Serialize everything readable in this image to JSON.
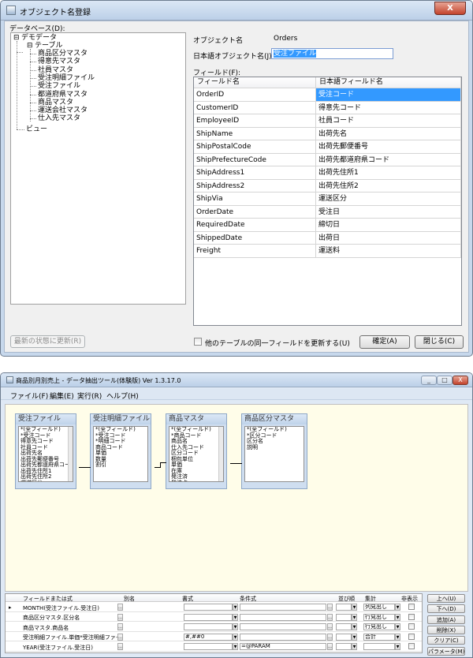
{
  "dialog": {
    "title": "オブジェクト名登録",
    "close_glyph": "X",
    "database_label": "データベース(D):",
    "tree": {
      "root": "デモデータ",
      "tables_node": "テーブル",
      "tables": [
        "商品区分マスタ",
        "得意先マスタ",
        "社員マスタ",
        "受注明細ファイル",
        "受注ファイル",
        "都道府県マスタ",
        "商品マスタ",
        "運送会社マスタ",
        "仕入先マスタ"
      ],
      "views_node": "ビュー"
    },
    "object_name_label": "オブジェクト名",
    "object_name_value": "Orders",
    "jp_object_name_label": "日本語オブジェクト名(J):",
    "jp_object_name_value": "受注ファイル",
    "fields_label": "フィールド(F):",
    "grid_headers": [
      "フィールド名",
      "日本語フィールド名"
    ],
    "grid_rows": [
      [
        "OrderID",
        "受注コード"
      ],
      [
        "CustomerID",
        "得意先コード"
      ],
      [
        "EmployeeID",
        "社員コード"
      ],
      [
        "ShipName",
        "出荷先名"
      ],
      [
        "ShipPostalCode",
        "出荷先郵便番号"
      ],
      [
        "ShipPrefectureCode",
        "出荷先都道府県コード"
      ],
      [
        "ShipAddress1",
        "出荷先住所1"
      ],
      [
        "ShipAddress2",
        "出荷先住所2"
      ],
      [
        "ShipVia",
        "運送区分"
      ],
      [
        "OrderDate",
        "受注日"
      ],
      [
        "RequiredDate",
        "締切日"
      ],
      [
        "ShippedDate",
        "出荷日"
      ],
      [
        "Freight",
        "運送料"
      ]
    ],
    "refresh_button": "最新の状態に更新(R)",
    "update_checkbox_label": "他のテーブルの同一フィールドを更新する(U)",
    "ok_button": "確定(A)",
    "close_button": "閉じる(C)"
  },
  "app": {
    "title": "商品別月別売上 - データ抽出ツール(体験版) Ver 1.3.17.0",
    "caption_min": "_",
    "caption_max": "□",
    "caption_close": "X",
    "menu": [
      "ファイル(F)",
      "編集(E)",
      "実行(R)",
      "ヘルプ(H)"
    ],
    "tables": [
      {
        "title": "受注ファイル",
        "fields": [
          "*(全フィールド)",
          "*受注コード",
          "得意先コード",
          "社員コード",
          "出荷先名",
          "出荷先郵便番号",
          "出荷先都道府県コード",
          "出荷先住所1",
          "出荷先住所2",
          "運送区分",
          "受注日",
          "締切日"
        ]
      },
      {
        "title": "受注明細ファイル",
        "fields": [
          "*(全フィールド)",
          "*受注コード",
          "*明細コード",
          "商品コード",
          "単価",
          "数量",
          "割引"
        ]
      },
      {
        "title": "商品マスタ",
        "fields": [
          "*(全フィールド)",
          "*商品コード",
          "商品名",
          "仕入先コード",
          "区分コード",
          "梱包単位",
          "単価",
          "在庫",
          "発注済",
          "発注点",
          "生産中止"
        ]
      },
      {
        "title": "商品区分マスタ",
        "fields": [
          "*(全フィールド)",
          "*区分コード",
          "区分名",
          "説明"
        ]
      }
    ],
    "grid_headers": [
      "フィールドまたは式",
      "別名",
      "書式",
      "条件式",
      "並び順",
      "集計",
      "非表示"
    ],
    "grid_rows": [
      {
        "marker": "▸",
        "field": "MONTH(受注ファイル.受注日)",
        "format": "",
        "condition": "",
        "agg": "列見出し"
      },
      {
        "marker": "",
        "field": "商品区分マスタ.区分名",
        "format": "",
        "condition": "",
        "agg": "行見出し"
      },
      {
        "marker": "",
        "field": "商品マスタ.商品名",
        "format": "",
        "condition": "",
        "agg": "行見出し"
      },
      {
        "marker": "",
        "field": "受注明細ファイル.単価*受注明細ファイ.",
        "format": "#,##0",
        "condition": "",
        "agg": "合計"
      },
      {
        "marker": "",
        "field": "YEAR(受注ファイル.受注日)",
        "format": "",
        "condition": "=@PARAM",
        "agg": ""
      }
    ],
    "side_buttons": [
      "上へ(U)",
      "下へ(D)",
      "追加(A)",
      "削除(X)",
      "クリア(C)",
      "パラメータ(M)"
    ]
  }
}
